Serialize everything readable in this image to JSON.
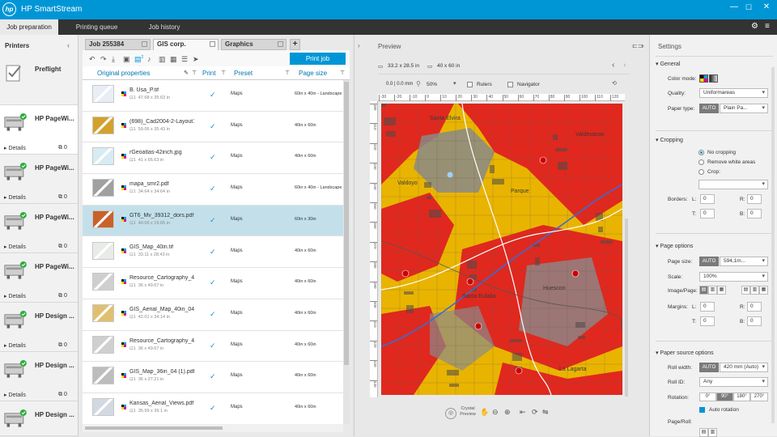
{
  "app": {
    "title": "HP SmartStream",
    "logo_text": "hp"
  },
  "nav": {
    "tabs": [
      {
        "label": "Job preparation"
      },
      {
        "label": "Printing queue"
      },
      {
        "label": "Job history"
      }
    ]
  },
  "printers": {
    "title": "Printers",
    "items": [
      {
        "name": "Preflight"
      },
      {
        "name": "HP PageWi...",
        "details": "Details",
        "count": "0"
      },
      {
        "name": "HP PageWi...",
        "details": "Details",
        "count": "0"
      },
      {
        "name": "HP PageWi...",
        "details": "Details",
        "count": "0"
      },
      {
        "name": "HP PageWi...",
        "details": "Details",
        "count": "0"
      },
      {
        "name": "HP Design ...",
        "details": "Details",
        "count": "0"
      },
      {
        "name": "HP Design ...",
        "details": "Details",
        "count": "0"
      },
      {
        "name": "HP Design ..."
      }
    ]
  },
  "jobs": {
    "tabs": [
      {
        "label": "Job 255384"
      },
      {
        "label": "GIS corp."
      },
      {
        "label": "Graphics"
      }
    ],
    "add_tab": "+",
    "toolbar_badge": "2",
    "print_button": "Print job",
    "columns": {
      "original": "Original properties",
      "print": "Print",
      "preset": "Preset",
      "page_size": "Page size"
    },
    "rows": [
      {
        "name": "B. Usa_P.tif",
        "copies": "1",
        "dims": "47.68 x 35.63 in",
        "preset": "Maps",
        "page_size": "60in x 40in - Landscape"
      },
      {
        "name": "(698)_Cad2004-2-Layout1.pdf",
        "copies": "1",
        "dims": "59.06 x 35.43 in",
        "preset": "Maps",
        "page_size": "40in x 60in"
      },
      {
        "name": "rGeoatlas-42inch.jpg",
        "copies": "1",
        "dims": "41 x 66.63 in",
        "preset": "Maps",
        "page_size": "40in x 60in"
      },
      {
        "name": "mapa_smr2.pdf",
        "copies": "1",
        "dims": "34.64 x 34.64 in",
        "preset": "Maps",
        "page_size": "60in x 40in - Landscape"
      },
      {
        "name": "GT6_Mv_39312_dors.pdf",
        "copies": "1",
        "dims": "40.06 x 19.65 in",
        "preset": "Maps",
        "page_size": "60in x 30in"
      },
      {
        "name": "GIS_Map_40in.tif",
        "copies": "1",
        "dims": "33.11 x 28.43 in",
        "preset": "Maps",
        "page_size": "40in x 60in"
      },
      {
        "name": "Resource_Cartography_4...",
        "copies": "1",
        "dims": "36 x 49.67 in",
        "preset": "Maps",
        "page_size": "40in x 60in"
      },
      {
        "name": "GIS_Aerial_Map_40in_04...",
        "copies": "1",
        "dims": "42.01 x 34.14 in",
        "preset": "Maps",
        "page_size": "40in x 60in"
      },
      {
        "name": "Resource_Cartography_4...",
        "copies": "1",
        "dims": "36 x 49.67 in",
        "preset": "Maps",
        "page_size": "40in x 60in"
      },
      {
        "name": "GIS_Map_36in_04 (1).pdf",
        "copies": "1",
        "dims": "36 x 27.21 in",
        "preset": "Maps",
        "page_size": "40in x 60in"
      },
      {
        "name": "Kansas_Aerial_Views.pdf",
        "copies": "1",
        "dims": "35.99 x 39.1 in",
        "preset": "Maps",
        "page_size": "40in x 60in"
      }
    ]
  },
  "preview": {
    "title": "Preview",
    "doc_size": "33.2 x 28.5 in",
    "page_size": "40 x 60 in",
    "coords": "0.0 | 0.0 mm",
    "zoom": "50%",
    "rulers": "Rulers",
    "navigator": "Navigator",
    "crystal_preview": "Crystal Preview",
    "ruler_ticks": [
      "-30",
      "-20",
      "-10",
      "0",
      "10",
      "20",
      "30",
      "40",
      "50",
      "60",
      "70",
      "80",
      "90",
      "100",
      "110",
      "120"
    ],
    "ruler_ticks_left": [
      "300",
      "310",
      "320",
      "330",
      "340",
      "350",
      "360",
      "370",
      "380",
      "390",
      "400",
      "410",
      "420",
      "430",
      "440"
    ],
    "map_labels": [
      "Santa Elvira",
      "Valdoyo",
      "Parque",
      "Santa Eulalia",
      "Huescon",
      "La Lagarta",
      "Valdevacas"
    ]
  },
  "settings": {
    "title": "Settings",
    "general": {
      "title": "General",
      "color_mode": "Color mode:",
      "quality_label": "Quality:",
      "quality": "Uniformareas",
      "paper_type_label": "Paper type:",
      "paper_type_auto": "AUTO",
      "paper_type": "Plain Pa..."
    },
    "cropping": {
      "title": "Cropping",
      "options": [
        "No cropping",
        "Remove white areas",
        "Crop:"
      ],
      "borders": "Borders:",
      "l": "L:",
      "r": "R:",
      "t": "T:",
      "b": "B:",
      "value": "0"
    },
    "page_options": {
      "title": "Page options",
      "page_size_label": "Page size:",
      "auto": "AUTO",
      "page_size": "594,1m...",
      "scale_label": "Scale:",
      "scale": "100%",
      "image_page_label": "Image/Page:",
      "margins_label": "Margins:",
      "l": "L:",
      "r": "R:",
      "t": "T:",
      "b": "B:",
      "value": "0"
    },
    "paper_source": {
      "title": "Paper source options",
      "roll_width_label": "Roll width:",
      "auto": "AUTO",
      "roll_width": "420 mm (Auto)",
      "roll_id_label": "Roll ID:",
      "roll_id": "Any",
      "rotation_label": "Rotation:",
      "rotations": [
        "0°",
        "90°",
        "180°",
        "270°"
      ],
      "auto_rotation": "Auto rotation",
      "page_roll_label": "Page/Roll:"
    }
  },
  "colors": {
    "accent": "#0096d6",
    "selected_row": "#c3e0ea",
    "nav_bg": "#333333"
  }
}
